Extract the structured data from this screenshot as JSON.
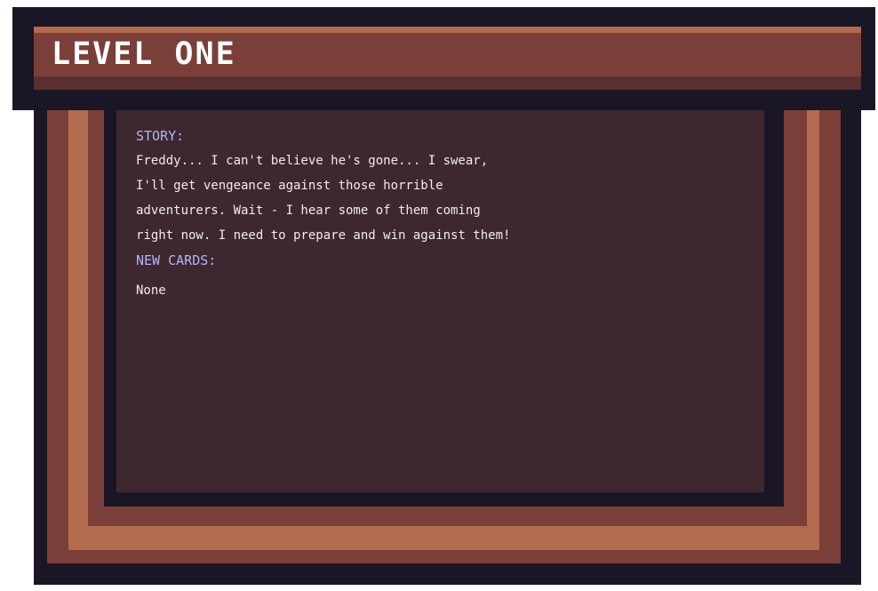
{
  "title": "LEVEL ONE",
  "story": {
    "heading": "STORY:",
    "lines": [
      "Freddy... I can't believe he's gone... I swear,",
      "I'll get vengeance against those horrible",
      "adventurers. Wait - I hear some of them coming",
      "right now. I need to prepare and win against them!"
    ]
  },
  "new_cards": {
    "heading": "NEW CARDS:",
    "value": "None"
  },
  "colors": {
    "dark_outline": "#1b1626",
    "brown": "#7a3f38",
    "orange": "#b56b4e",
    "panel": "#3d2830",
    "heading_text": "#b4b4f2",
    "body_text": "#f2ece9"
  }
}
